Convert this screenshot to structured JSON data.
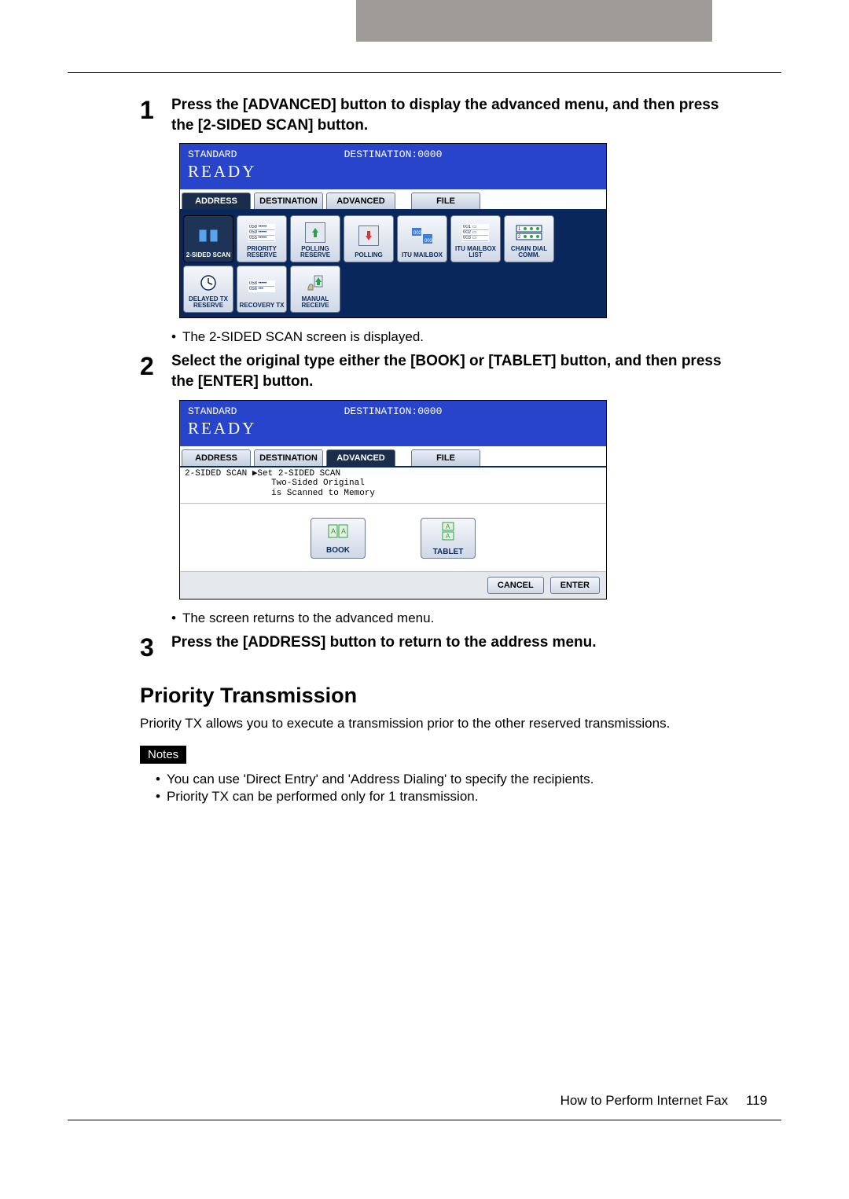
{
  "steps": {
    "s1_num": "1",
    "s1_text": "Press the [ADVANCED] button to display the advanced menu, and then press the [2-SIDED SCAN] button.",
    "s1_bullet": "The 2-SIDED SCAN screen is displayed.",
    "s2_num": "2",
    "s2_text": "Select the original type either the [BOOK] or [TABLET] button, and then press the [ENTER] button.",
    "s2_bullet": "The screen returns to the advanced menu.",
    "s3_num": "3",
    "s3_text": "Press the [ADDRESS] button to return to the address menu."
  },
  "section": {
    "title": "Priority Transmission",
    "desc": "Priority TX allows you to execute a transmission prior to the other reserved transmissions.",
    "notes_label": "Notes",
    "note1": "You can use 'Direct Entry' and 'Address Dialing' to specify the recipients.",
    "note2": "Priority TX can be performed only for 1 transmission."
  },
  "fax": {
    "status_standard": "STANDARD",
    "status_dest": "DESTINATION:0000",
    "ready": "READY",
    "tab_address": "ADDRESS",
    "tab_destination": "DESTINATION",
    "tab_advanced": "ADVANCED",
    "tab_file": "FILE",
    "btn_2sided": "2-SIDED SCAN",
    "btn_priority_reserve": "PRIORITY RESERVE",
    "btn_polling_reserve": "POLLING RESERVE",
    "btn_polling": "POLLING",
    "btn_itu_mailbox": "ITU MAILBOX",
    "btn_itu_mailbox_list": "ITU MAILBOX LIST",
    "btn_chain_dial": "CHAIN DIAL COMM.",
    "btn_delayed_tx": "DELAYED TX RESERVE",
    "btn_recovery_tx": "RECOVERY TX",
    "btn_manual_receive": "MANUAL RECEIVE",
    "context_line1": "2-SIDED SCAN ▶Set 2-SIDED SCAN",
    "context_line2": "Two-Sided Original",
    "context_line3": "is Scanned to Memory",
    "btn_book": "BOOK",
    "btn_tablet": "TABLET",
    "btn_cancel": "CANCEL",
    "btn_enter": "ENTER"
  },
  "footer": {
    "title": "How to Perform Internet Fax",
    "page": "119"
  }
}
